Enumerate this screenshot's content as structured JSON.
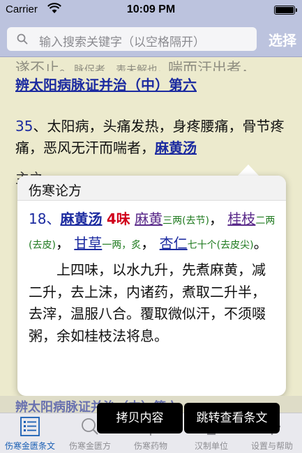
{
  "status_bar": {
    "carrier": "Carrier",
    "time": "10:09 PM"
  },
  "search": {
    "placeholder": "输入搜索关键字（以空格隔开）",
    "select_label": "选择"
  },
  "content": {
    "prev_line_a": "遂不止。",
    "prev_line_b": "脉促者，表未解也。",
    "prev_line_c": "喘而汗出者，",
    "section_heading": "辨太阳病脉证并治（中）第六",
    "clause_number": "35",
    "clause_text_1": "、太阳病，头痛发热，身疼腰痛，骨节疼痛，恶风无汗而喘者，",
    "clause_link": "麻黄汤",
    "clause_text_2": "主之。",
    "next_section_cut": "辨太阳病脉证并治（中）第六"
  },
  "popover": {
    "title": "伤寒论方",
    "formula_number": "18、",
    "formula_name": "麻黄汤",
    "herb_count": "4味",
    "herbs": [
      {
        "name": "麻黄",
        "dose": "三两(去节)",
        "sep": "，"
      },
      {
        "name": "桂枝",
        "dose": "二两(去皮)",
        "sep": "，"
      },
      {
        "name": "甘草",
        "dose": "一两，炙",
        "sep": "，"
      },
      {
        "name": "杏仁",
        "dose": "七十个(去皮尖)",
        "sep": "。"
      }
    ],
    "method": "上四味，以水九升，先煮麻黄，减二升，去上沫，内诸药，煮取二升半，去滓，温服八合。覆取微似汗，不须啜粥，余如桂枝法将息。"
  },
  "actions": {
    "copy_label": "拷贝内容",
    "jump_label": "跳转查看条文"
  },
  "tabs": [
    {
      "label": "伤寒金匮条文",
      "icon": "list-icon",
      "active": true
    },
    {
      "label": "伤寒金匮方",
      "icon": "search-icon",
      "active": false
    },
    {
      "label": "伤寒药物",
      "icon": "herb-icon",
      "active": false
    },
    {
      "label": "汉制单位",
      "icon": "scale-icon",
      "active": false
    },
    {
      "label": "设置与帮助",
      "icon": "gear-icon",
      "active": false
    }
  ],
  "colors": {
    "link_blue": "#1c2ba0",
    "count_red": "#d0021b",
    "dose_green": "#1f7a1f",
    "herb_purple": "#5a2a8a",
    "tab_active": "#1a5fb4"
  }
}
